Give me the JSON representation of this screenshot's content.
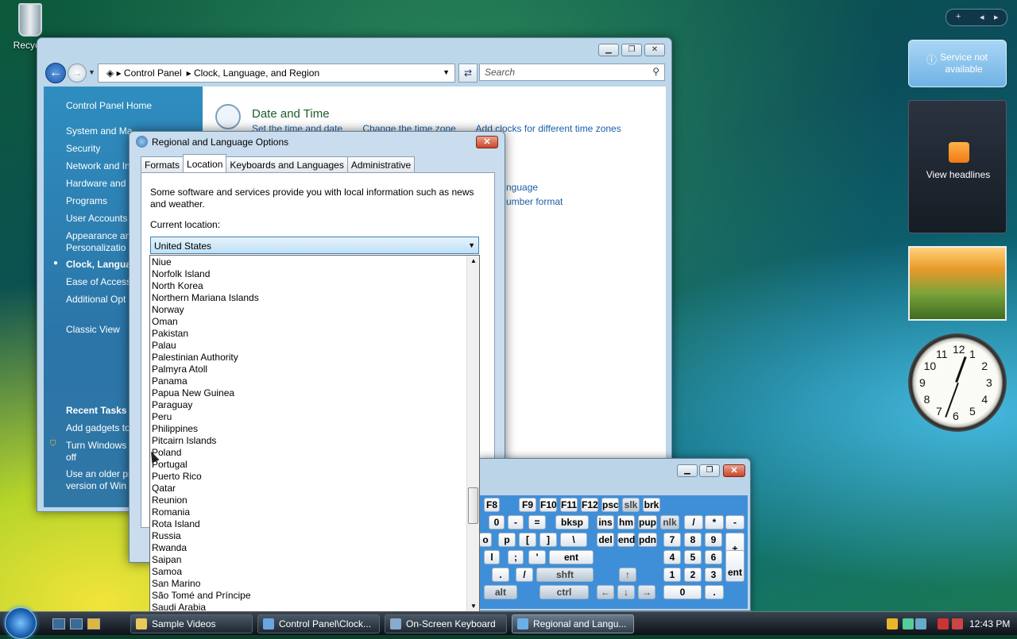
{
  "desktop": {
    "recycle_label": "Recycle"
  },
  "control_panel": {
    "address": [
      "Control Panel",
      "Clock, Language, and Region"
    ],
    "search_placeholder": "Search",
    "nav": [
      "Control Panel Home",
      "System and Ma",
      "Security",
      "Network and In",
      "Hardware and",
      "Programs",
      "User Accounts",
      "Appearance an",
      "Personalizatio",
      "Clock, Languag",
      "Ease of Access",
      "Additional Opt",
      "Classic View"
    ],
    "recent_title": "Recent Tasks",
    "recent": [
      "Add gadgets to",
      "Turn Windows",
      "off",
      "Use an older pr",
      "version of Win"
    ],
    "section_title": "Date and Time",
    "section_links": [
      "Set the time and date",
      "Change the time zone",
      "Add clocks for different time zones"
    ],
    "lang_link1": "nguage",
    "lang_link2": "umber format"
  },
  "dialog": {
    "title": "Regional and Language Options",
    "close": "✕",
    "tabs": [
      "Formats",
      "Location",
      "Keyboards and Languages",
      "Administrative"
    ],
    "description": "Some software and services provide you with local information such as news and weather.",
    "current_label": "Current location:",
    "selected": "United States",
    "countries": [
      "Niue",
      "Norfolk Island",
      "North Korea",
      "Northern Mariana Islands",
      "Norway",
      "Oman",
      "Pakistan",
      "Palau",
      "Palestinian Authority",
      "Palmyra Atoll",
      "Panama",
      "Papua New Guinea",
      "Paraguay",
      "Peru",
      "Philippines",
      "Pitcairn Islands",
      "Poland",
      "Portugal",
      "Puerto Rico",
      "Qatar",
      "Reunion",
      "Romania",
      "Rota Island",
      "Russia",
      "Rwanda",
      "Saipan",
      "Samoa",
      "San Marino",
      "São Tomé and Príncipe",
      "Saudi Arabia"
    ]
  },
  "osk": {
    "keys": [
      "F8",
      "F9",
      "F10",
      "F11",
      "F12",
      "psc",
      "slk",
      "brk",
      "0",
      "-",
      "=",
      "bksp",
      "ins",
      "hm",
      "pup",
      "nlk",
      "/",
      "*",
      "-",
      "o",
      "p",
      "[",
      "]",
      "\\",
      "del",
      "end",
      "pdn",
      "7",
      "8",
      "9",
      "+",
      "l",
      ";",
      "'",
      "ent",
      "4",
      "5",
      "6",
      ".",
      "/",
      "shft",
      "↑",
      "1",
      "2",
      "3",
      "ent",
      "alt",
      "ctrl",
      "←",
      "↓",
      "→",
      "0",
      "."
    ]
  },
  "gadgets": {
    "weather": "Service not available",
    "feed": "View headlines",
    "clock_numbers": [
      "12",
      "1",
      "2",
      "3",
      "4",
      "5",
      "6",
      "7",
      "8",
      "9",
      "10",
      "11"
    ]
  },
  "taskbar": {
    "buttons": [
      "Sample Videos",
      "Control Panel\\Clock...",
      "On-Screen Keyboard",
      "Regional and Langu..."
    ],
    "time": "12:43 PM"
  }
}
